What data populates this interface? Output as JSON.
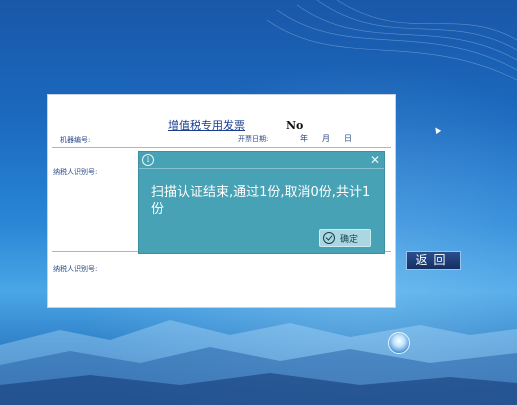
{
  "invoice": {
    "title": "增值税专用发票",
    "no_label": "No",
    "machine_no_label": "机器编号:",
    "issue_date_label": "开票日期:",
    "year": "年",
    "month": "月",
    "day": "日",
    "buyer_tax_id_label": "纳税人识别号:",
    "seller_tax_id_label": "纳税人识别号:"
  },
  "dialog": {
    "message": "扫描认证结束,通过1份,取消0份,共计1份",
    "ok_label": "确定",
    "info_icon": "info-circle",
    "close_icon": "close-x"
  },
  "back_button": {
    "label": "返回"
  },
  "colors": {
    "dialog_bg": "#46a2b4",
    "desktop_blue": "#1b6ac0",
    "back_button_bg": "#1e3f78"
  }
}
